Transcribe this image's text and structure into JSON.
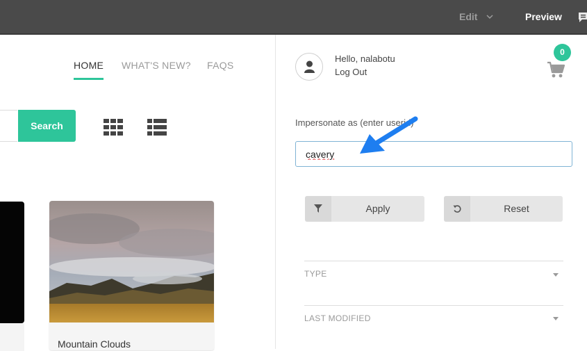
{
  "topbar": {
    "edit_label": "Edit",
    "preview_label": "Preview"
  },
  "nav": {
    "home": "HOME",
    "whats_new": "WHAT'S NEW?",
    "faqs": "FAQS"
  },
  "search": {
    "button_label": "Search",
    "placeholder": ""
  },
  "cards": [
    {
      "title": "Mountain Clouds"
    }
  ],
  "user_panel": {
    "greeting": "Hello, nalabotu",
    "logout": "Log Out",
    "cart_count": "0",
    "impersonate_label": "Impersonate as (enter userid)",
    "impersonate_value": "cavery",
    "apply_label": "Apply",
    "reset_label": "Reset",
    "filters": [
      {
        "label": "TYPE"
      },
      {
        "label": "LAST MODIFIED"
      }
    ]
  },
  "colors": {
    "accent": "#2ec59a",
    "topbar": "#4a4a4a",
    "input_border": "#7fb3d5",
    "arrow": "#1e7ef0"
  }
}
